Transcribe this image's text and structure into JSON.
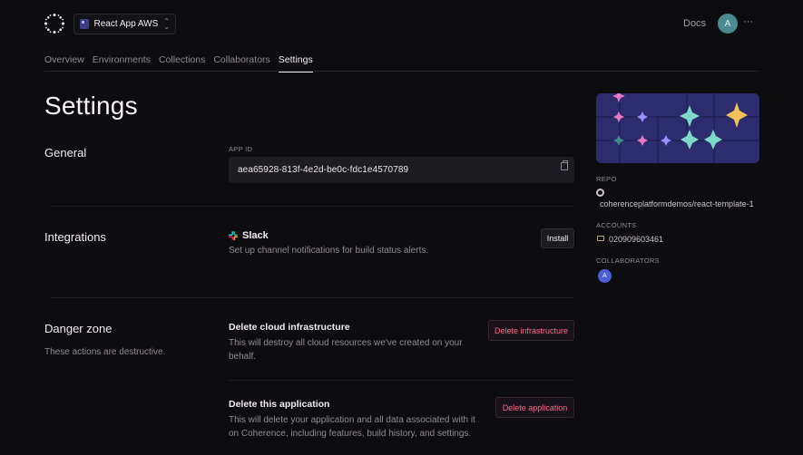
{
  "app": {
    "switcher_name": "React App AWS"
  },
  "header": {
    "docs_label": "Docs",
    "avatar_initial": "A",
    "more_label": "···"
  },
  "tabs": [
    {
      "label": "Overview",
      "active": false
    },
    {
      "label": "Environments",
      "active": false
    },
    {
      "label": "Collections",
      "active": false
    },
    {
      "label": "Collaborators",
      "active": false
    },
    {
      "label": "Settings",
      "active": true
    }
  ],
  "page": {
    "title": "Settings"
  },
  "general": {
    "title": "General",
    "app_id_label": "APP ID",
    "app_id_value": "aea65928-813f-4e2d-be0c-fdc1e4570789"
  },
  "integrations": {
    "title": "Integrations",
    "slack": {
      "name": "Slack",
      "description": "Set up channel notifications for build status alerts.",
      "install_label": "Install"
    }
  },
  "danger_zone": {
    "title": "Danger zone",
    "description": "These actions are destructive.",
    "infra": {
      "title": "Delete cloud infrastructure",
      "description": "This will destroy all cloud resources we've created on your behalf.",
      "button_label": "Delete infrastructure"
    },
    "application": {
      "title": "Delete this application",
      "description": "This will delete your application and all data associated with it on Coherence, including features, build history, and settings.",
      "button_label": "Delete application"
    }
  },
  "sidebar": {
    "repo_label": "REPO",
    "repo_value": "coherenceplatformdemos/react-template-1",
    "accounts_label": "ACCOUNTS",
    "accounts_value": "020909603461",
    "collaborators_label": "COLLABORATORS",
    "collaborator_initial": "A"
  },
  "colors": {
    "background": "#0d0c0f",
    "danger": "#ff6b8a",
    "banner": "#2d2c6e",
    "avatar_top": "#4b8a90",
    "collaborator_avatar": "#4c5fd6"
  }
}
